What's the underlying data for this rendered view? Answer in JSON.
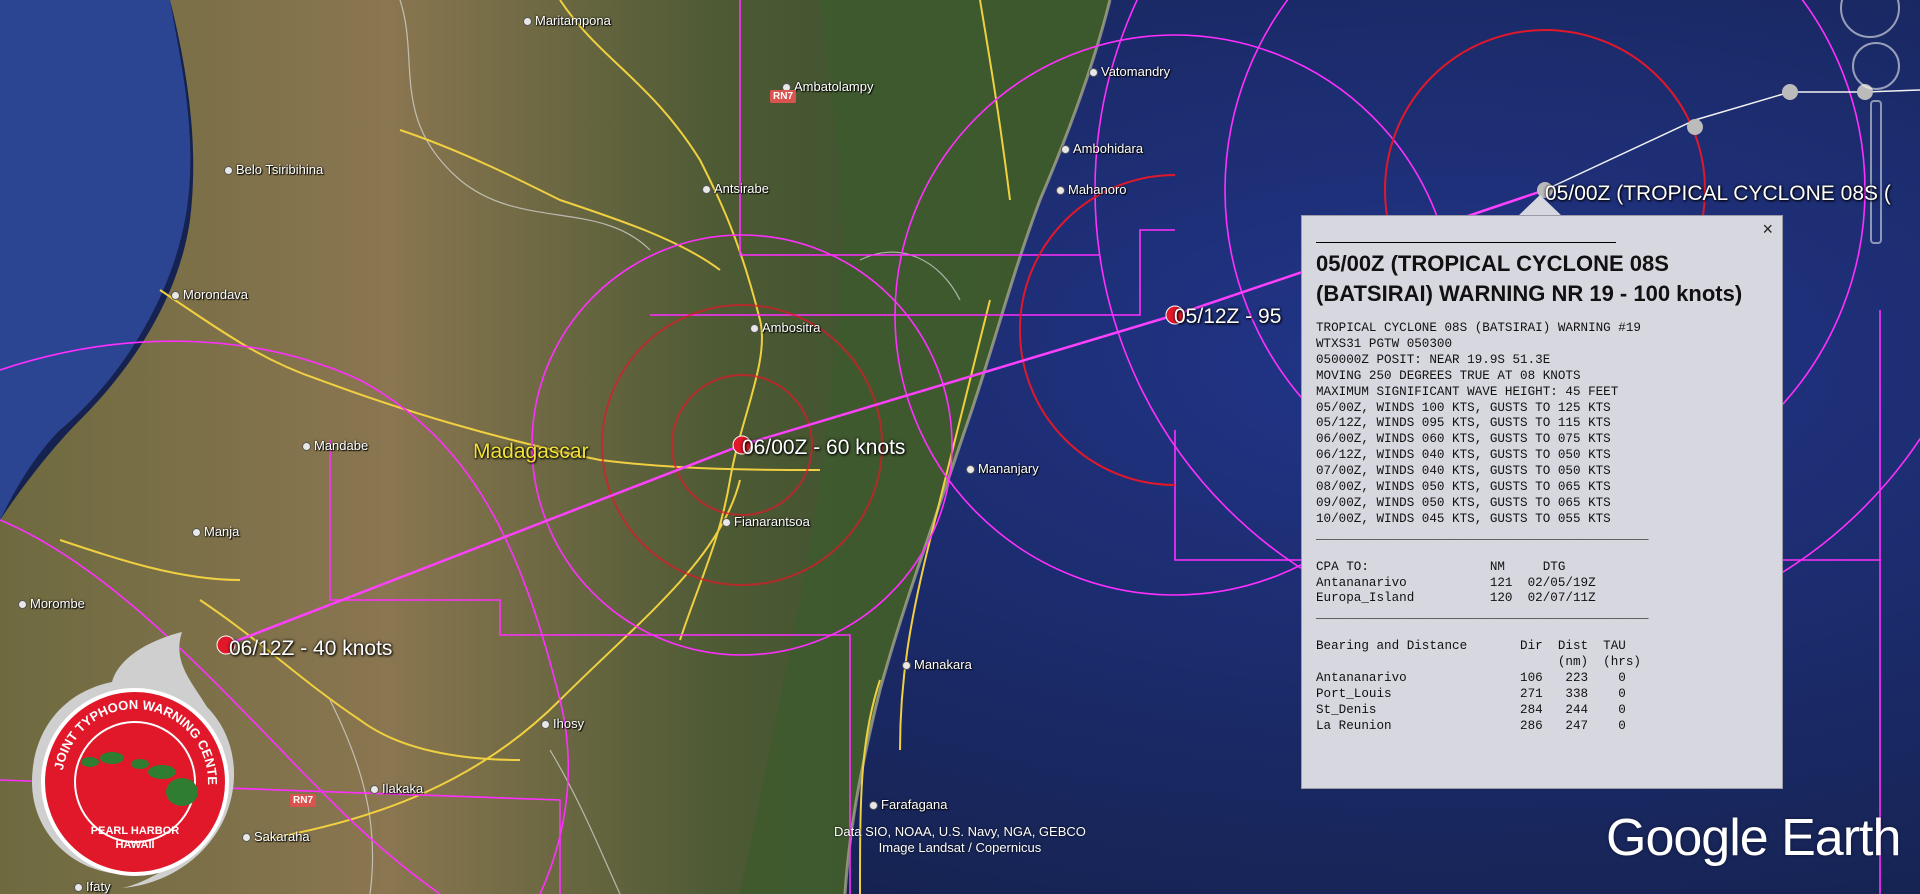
{
  "places": [
    {
      "id": "maritampona",
      "name": "Maritampona"
    },
    {
      "id": "ambatolampy",
      "name": "Ambatolampy"
    },
    {
      "id": "vatomandry",
      "name": "Vatomandry"
    },
    {
      "id": "belo-tsiribihina",
      "name": "Belo Tsiribihina"
    },
    {
      "id": "antsirabe",
      "name": "Antsirabe"
    },
    {
      "id": "ambohidara",
      "name": "Ambohidara"
    },
    {
      "id": "mahanoro",
      "name": "Mahanoro"
    },
    {
      "id": "morondava",
      "name": "Morondava"
    },
    {
      "id": "ambositra",
      "name": "Ambositra"
    },
    {
      "id": "mandabe",
      "name": "Mandabe"
    },
    {
      "id": "mananjary",
      "name": "Mananjary"
    },
    {
      "id": "fianarantsoa",
      "name": "Fianarantsoa"
    },
    {
      "id": "manja",
      "name": "Manja"
    },
    {
      "id": "morombe",
      "name": "Morombe"
    },
    {
      "id": "manakara",
      "name": "Manakara"
    },
    {
      "id": "ihosy",
      "name": "Ihosy"
    },
    {
      "id": "ilakaka",
      "name": "Ilakaka"
    },
    {
      "id": "sakaraha",
      "name": "Sakaraha"
    },
    {
      "id": "farafangana",
      "name": "Farafagana"
    },
    {
      "id": "ifaty",
      "name": "Ifaty"
    }
  ],
  "country_label": "Madagascar",
  "road_shields": [
    "RN7",
    "RN7"
  ],
  "track_points": [
    {
      "id": "05-00z",
      "label": "05/00Z (TROPICAL CYCLONE 08S ("
    },
    {
      "id": "05-12z",
      "label": "05/12Z - 95"
    },
    {
      "id": "06-00z",
      "label": "06/00Z - 60 knots"
    },
    {
      "id": "06-12z",
      "label": "06/12Z - 40 knots"
    }
  ],
  "popup": {
    "close_icon": "×",
    "title": "05/00Z (TROPICAL CYCLONE 08S (BATSIRAI) WARNING NR 19 - 100 knots)",
    "body": "TROPICAL CYCLONE 08S (BATSIRAI) WARNING #19\nWTXS31 PGTW 050300\n050000Z POSIT: NEAR 19.9S 51.3E\nMOVING 250 DEGREES TRUE AT 08 KNOTS\nMAXIMUM SIGNIFICANT WAVE HEIGHT: 45 FEET\n05/00Z, WINDS 100 KTS, GUSTS TO 125 KTS\n05/12Z, WINDS 095 KTS, GUSTS TO 115 KTS\n06/00Z, WINDS 060 KTS, GUSTS TO 075 KTS\n06/12Z, WINDS 040 KTS, GUSTS TO 050 KTS\n07/00Z, WINDS 040 KTS, GUSTS TO 050 KTS\n08/00Z, WINDS 050 KTS, GUSTS TO 065 KTS\n09/00Z, WINDS 050 KTS, GUSTS TO 065 KTS\n10/00Z, WINDS 045 KTS, GUSTS TO 055 KTS\n____________________________________________\n\nCPA TO:                NM     DTG\nAntananarivo           121  02/05/19Z\nEuropa_Island          120  02/07/11Z\n____________________________________________\n\nBearing and Distance       Dir  Dist  TAU\n                                (nm)  (hrs)\nAntananarivo               106   223    0\nPort_Louis                 271   338    0\nSt_Denis                   284   244    0\nLa Reunion                 286   247    0"
  },
  "attribution": {
    "line1": "Data SIO, NOAA, U.S. Navy, NGA, GEBCO",
    "line2": "Image Landsat / Copernicus"
  },
  "google_earth_logo": "Google Earth",
  "jtwc_logo": {
    "ring_text": "JOINT TYPHOON WARNING CENTER",
    "bottom_line1": "PEARL HARBOR",
    "bottom_line2": "HAWAII"
  },
  "colors": {
    "ocean": "#1b2c6e",
    "land": "#6b6a3c",
    "track": "#ff40ff",
    "warning": "#e0182a",
    "roads": "#f0d040"
  }
}
